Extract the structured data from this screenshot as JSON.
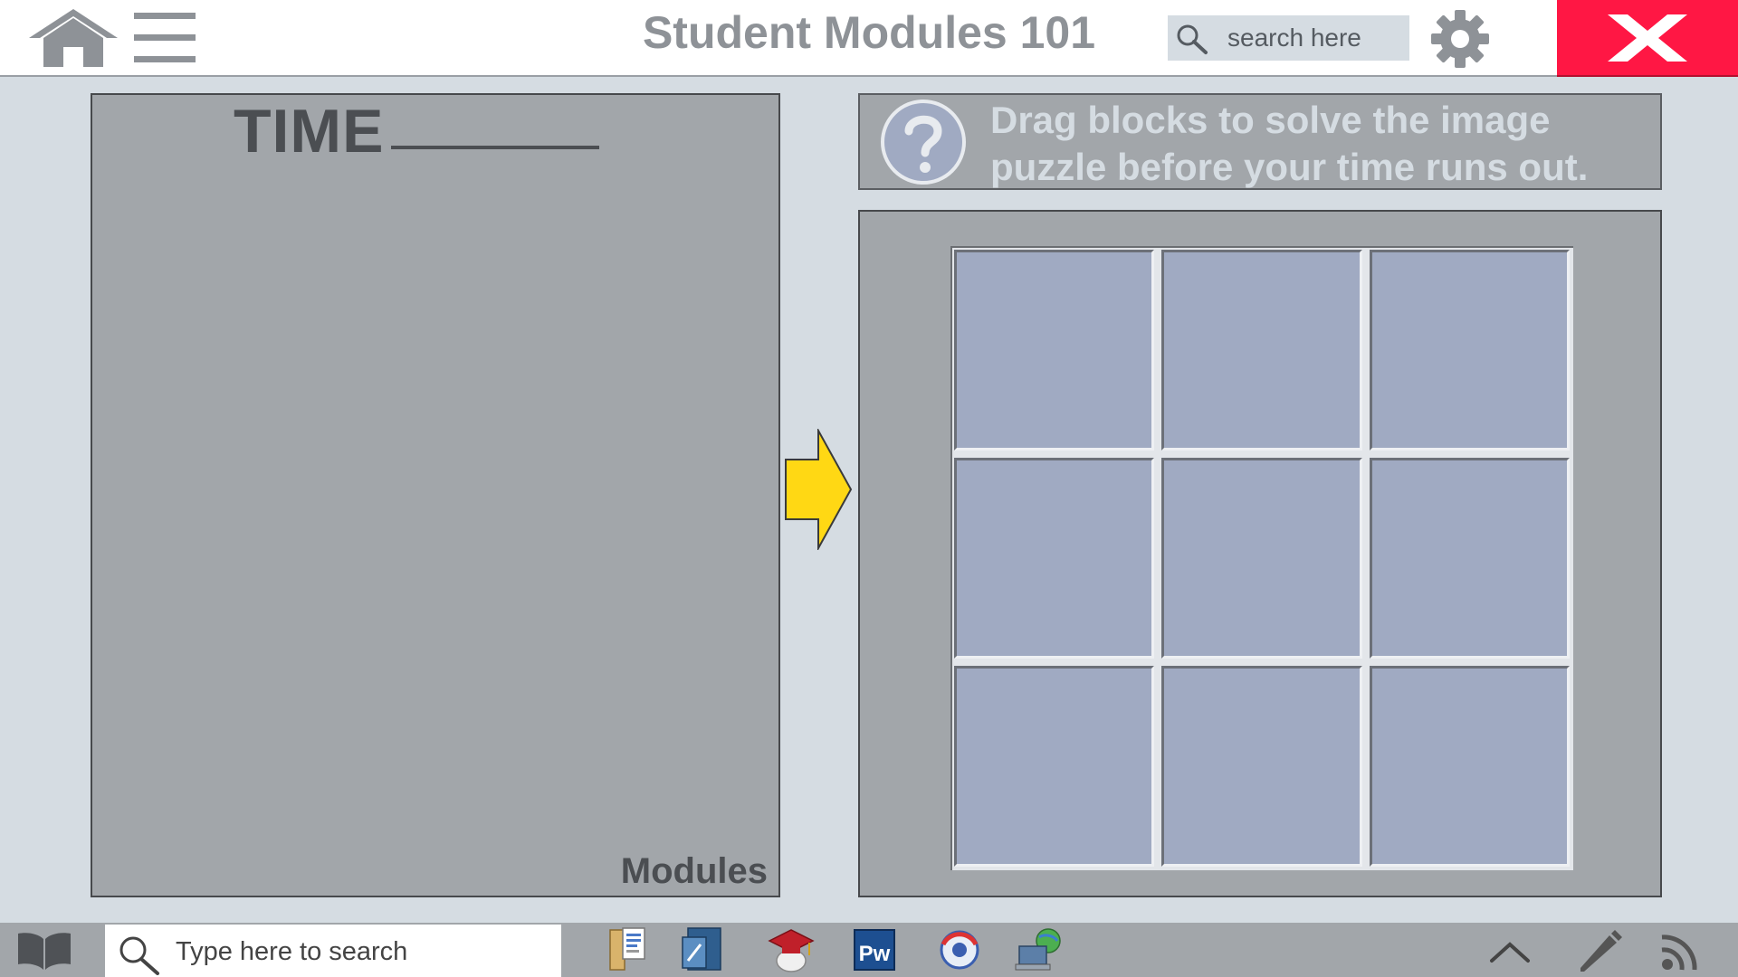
{
  "header": {
    "title": "Student Modules 101",
    "search": {
      "placeholder": "search here",
      "icon": "search-icon"
    },
    "icons": [
      "home-icon",
      "hamburger-menu-icon",
      "gear-icon",
      "close-icon"
    ],
    "close_color": "#ff1744"
  },
  "left_panel": {
    "time_label": "TIME",
    "footer_label": "Modules"
  },
  "instruction": {
    "icon": "question-mark-icon",
    "line1": "Drag blocks to solve the image",
    "line2": "puzzle before your time runs out."
  },
  "puzzle": {
    "rows": 3,
    "cols": 3,
    "block_color": "#a0aac2"
  },
  "arrow_color": "#ffd814",
  "taskbar": {
    "search_placeholder": "Type here to search",
    "apps": [
      "file-manager-icon",
      "document-editor-icon",
      "graduation-cap-icon",
      "pw-app-icon",
      "browser-icon",
      "network-computer-icon"
    ],
    "pw_label": "Pw",
    "tray": [
      "chevron-up-icon",
      "pencil-icon",
      "rss-feed-icon"
    ]
  }
}
